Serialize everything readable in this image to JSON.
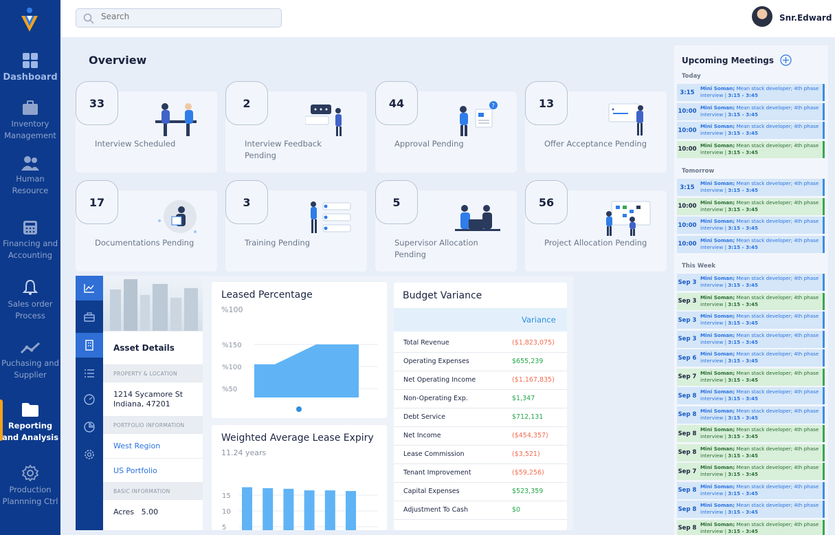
{
  "nav": [
    {
      "label": "Dashboard",
      "icon": "grid-icon"
    },
    {
      "label": "Inventory Management",
      "icon": "briefcase-icon"
    },
    {
      "label": "Human Resource",
      "icon": "people-icon"
    },
    {
      "label": "Financing and Accounting",
      "icon": "calculator-icon"
    },
    {
      "label": "Sales order Process",
      "icon": "bell-icon"
    },
    {
      "label": "Puchasing and Supplier",
      "icon": "trend-icon"
    },
    {
      "label": "Reporting and Analysis",
      "icon": "folder-icon"
    },
    {
      "label": "Production Plannning Ctrl",
      "icon": "gear-icon"
    }
  ],
  "header": {
    "search_placeholder": "Search",
    "user_name": "Snr.Edward"
  },
  "overview": {
    "title": "Overview",
    "cards": [
      {
        "count": "33",
        "label": "Interview Scheduled"
      },
      {
        "count": "2",
        "label": "Interview  Feedback Pending"
      },
      {
        "count": "44",
        "label": "Approval Pending"
      },
      {
        "count": "13",
        "label": "Offer Acceptance Pending"
      },
      {
        "count": "17",
        "label": "Documentations Pending"
      },
      {
        "count": "3",
        "label": "Training Pending"
      },
      {
        "count": "5",
        "label": "Supervisor Allocation Pending"
      },
      {
        "count": "56",
        "label": "Project Allocation Pending"
      }
    ]
  },
  "asset": {
    "title": "Asset Details",
    "sec_property": "PROPERTY & LOCATION",
    "address": "1214 Sycamore St Indiana, 47201",
    "sec_portfolio": "PORTFOLIO INFORMATION",
    "region": "West Region",
    "portfolio": "US Portfolio",
    "sec_basic": "BASIC INFORMATION",
    "acres": "Acres   5.00"
  },
  "leased": {
    "title": "Leased Percentage",
    "subtitle": "%100",
    "chart_data": {
      "type": "area",
      "x": [
        0,
        1,
        2,
        3
      ],
      "values": [
        105,
        105,
        150,
        150
      ],
      "ytick_labels": [
        "%150",
        "%100",
        "%50"
      ],
      "ylim": [
        30,
        170
      ],
      "color": "#60b4f5"
    }
  },
  "walt": {
    "title": "Weighted Average Lease Expiry",
    "subtitle": "11.24 years",
    "chart_data": {
      "type": "bar",
      "values": [
        17.5,
        17.2,
        17,
        16.5,
        16.5,
        16.3
      ],
      "ytick_labels": [
        "15",
        "10",
        "5"
      ],
      "ylim": [
        0,
        20
      ],
      "color": "#60b4f5"
    }
  },
  "budget": {
    "title": "Budget Variance",
    "column": "Variance",
    "rows": [
      {
        "label": "Total Revenue",
        "value": "($1,823,075)",
        "neg": true
      },
      {
        "label": "Operating Expenses",
        "value": "$655,239",
        "neg": false
      },
      {
        "label": "Net Operating Income",
        "value": "($1,167,835)",
        "neg": true
      },
      {
        "label": "Non-Operating Exp.",
        "value": "$1,347",
        "neg": false
      },
      {
        "label": "Debt Service",
        "value": "$712,131",
        "neg": false
      },
      {
        "label": "Net Income",
        "value": "($454,357)",
        "neg": true
      },
      {
        "label": "Lease Commission",
        "value": "($3,521)",
        "neg": true
      },
      {
        "label": "Tenant Improvement",
        "value": "($59,256)",
        "neg": true
      },
      {
        "label": "Capital Expenses",
        "value": "$523,359",
        "neg": false
      },
      {
        "label": "Adjustment To Cash",
        "value": "$0",
        "neg": false
      }
    ]
  },
  "meetings": {
    "title": "Upcoming Meetings",
    "groups": [
      {
        "label": "Today",
        "items": [
          {
            "time": "3:15",
            "color": "blue"
          },
          {
            "time": "10:00",
            "color": "blue"
          },
          {
            "time": "10:00",
            "color": "blue"
          },
          {
            "time": "10:00",
            "color": "green"
          }
        ]
      },
      {
        "label": "Tomorrow",
        "items": [
          {
            "time": "3:15",
            "color": "blue"
          },
          {
            "time": "10:00",
            "color": "green"
          },
          {
            "time": "10:00",
            "color": "blue"
          },
          {
            "time": "10:00",
            "color": "blue"
          }
        ]
      },
      {
        "label": "This Week",
        "items": [
          {
            "time": "Sep 3",
            "color": "blue"
          },
          {
            "time": "Sep 3",
            "color": "green"
          },
          {
            "time": "Sep 3",
            "color": "blue"
          },
          {
            "time": "Sep 3",
            "color": "blue"
          },
          {
            "time": "Sep 6",
            "color": "blue"
          },
          {
            "time": "Sep 7",
            "color": "green"
          },
          {
            "time": "Sep 8",
            "color": "blue"
          },
          {
            "time": "Sep 8",
            "color": "blue"
          },
          {
            "time": "Sep 8",
            "color": "green"
          },
          {
            "time": "Sep 8",
            "color": "green"
          },
          {
            "time": "Sep 7",
            "color": "green"
          },
          {
            "time": "Sep 8",
            "color": "blue"
          },
          {
            "time": "Sep 8",
            "color": "blue"
          },
          {
            "time": "Sep 8",
            "color": "green"
          }
        ]
      }
    ],
    "entry_name": "Mini Soman;",
    "entry_desc": " Mean stack developer; 4th phase interview | ",
    "entry_time": "3:15 - 3:45"
  }
}
